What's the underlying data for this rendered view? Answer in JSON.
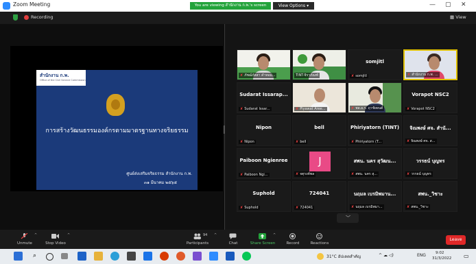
{
  "window": {
    "title": "Zoom Meeting",
    "banner": "You are viewing สำนักงาน ก.พ.'s screen",
    "view_options": "View Options ▾",
    "controls": [
      "—",
      "▢",
      "✕"
    ]
  },
  "status": {
    "recording": "Recording",
    "view": "View"
  },
  "shared_screen": {
    "org_name": "สำนักงาน ก.พ.",
    "org_sub": "Office of the Civil Service Commission",
    "title": "การสร้างวัฒนธรรมองค์กรตามมาตรฐานทางจริยธรรม",
    "footer_line1": "ศูนย์ส่งเสริมจริยธรรม  สำนักงาน ก.พ.",
    "footer_line2": "๓๑ มีนาคม ๒๕๖๕"
  },
  "participants": [
    {
      "name": "",
      "label": "ภัชฌ์ภัสสา คำหอม...",
      "muted": true,
      "video": true
    },
    {
      "name": "",
      "label": "TINT-จิราภัณฑ์",
      "muted": false,
      "video": true
    },
    {
      "name": "somjitl",
      "label": "somjitl",
      "muted": true,
      "video": false
    },
    {
      "name": "",
      "label": "สำนักงาน ก.พ. ...",
      "muted": true,
      "video": true
    },
    {
      "name": "Sudarat  Issarap...",
      "label": "Sudarat Issar...",
      "muted": true,
      "video": false
    },
    {
      "name": "",
      "label": "Piyawat Aree...",
      "muted": true,
      "video": true
    },
    {
      "name": "",
      "label": "พล.อ.ร. ฤาชัยยนต์",
      "muted": true,
      "video": true
    },
    {
      "name": "Vorapot NSC2",
      "label": "Vorapot NSC2",
      "muted": true,
      "video": false
    },
    {
      "name": "Nipon",
      "label": "Nipon",
      "muted": true,
      "video": false
    },
    {
      "name": "bell",
      "label": "bell",
      "muted": true,
      "video": false
    },
    {
      "name": "Phiriyatorn (TINT)",
      "label": "Phiriyatorn (T...",
      "muted": true,
      "video": false
    },
    {
      "name": "จิณพงษ์  ศจ. สำนั...",
      "label": "จิณพงษ์  ศจ. ส...",
      "muted": true,
      "video": false
    },
    {
      "name": "Paiboon Ngienree",
      "label": "Paiboon Ngi...",
      "muted": true,
      "video": false
    },
    {
      "name": "",
      "label": "จตุรงค์พล",
      "muted": true,
      "video": false,
      "avatar": "J"
    },
    {
      "name": "สพน. นคร  สุวัฒน...",
      "label": "สพน. นคร  สุ...",
      "muted": true,
      "video": false
    },
    {
      "name": "วรรธน์  บุญทร",
      "label": "วรรธน์ บุญทร",
      "muted": true,
      "video": false
    },
    {
      "name": "Suphold",
      "label": "Suphold",
      "muted": true,
      "video": false
    },
    {
      "name": "724041",
      "label": "724041",
      "muted": true,
      "video": false
    },
    {
      "name": "นฤมล เบรมิพมาน...",
      "label": "นฤมล เบรมิพมา...",
      "muted": true,
      "video": false
    },
    {
      "name": "สพน._วิชาะ",
      "label": "สพน._วิชาะ",
      "muted": true,
      "video": false
    }
  ],
  "toolbar": {
    "unmute": "Unmute",
    "stop_video": "Stop Video",
    "participants": "Participants",
    "participants_count": "94",
    "chat": "Chat",
    "share_screen": "Share Screen",
    "record": "Record",
    "reactions": "Reactions",
    "leave": "Leave"
  },
  "taskbar": {
    "weather": "31°C  อัปเดตสำคัญ",
    "lang": "ENG",
    "time": "9:02",
    "date": "31/3/2022"
  },
  "colors": {
    "zoom_blue": "#2d8cff",
    "share_green": "#23a33b",
    "leave_red": "#e02828",
    "active_speaker": "#e0c000"
  }
}
